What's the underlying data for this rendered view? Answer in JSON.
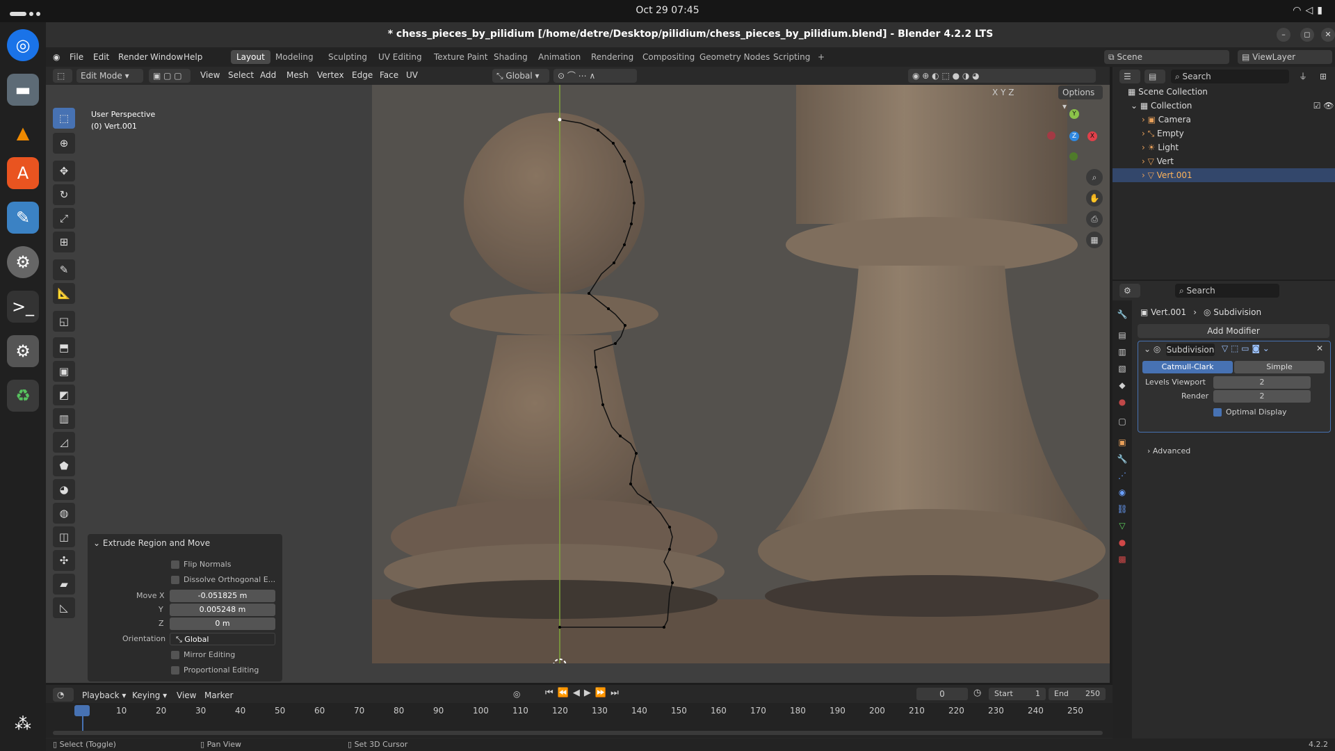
{
  "system": {
    "clock": "Oct 29  07:45"
  },
  "window": {
    "title": "* chess_pieces_by_pilidium [/home/detre/Desktop/pilidium/chess_pieces_by_pilidium.blend] - Blender 4.2.2 LTS"
  },
  "menu": [
    "File",
    "Edit",
    "Render",
    "Window",
    "Help"
  ],
  "workspaces": [
    "Layout",
    "Modeling",
    "Sculpting",
    "UV Editing",
    "Texture Paint",
    "Shading",
    "Animation",
    "Rendering",
    "Compositing",
    "Geometry Nodes",
    "Scripting"
  ],
  "scene": {
    "scene_label": "Scene",
    "viewlayer_label": "ViewLayer"
  },
  "viewport_header": {
    "mode": "Edit Mode",
    "menus": [
      "View",
      "Select",
      "Add",
      "Mesh",
      "Vertex",
      "Edge",
      "Face",
      "UV"
    ],
    "orientation": "Global",
    "options": "Options",
    "axes": [
      "X",
      "Y",
      "Z"
    ]
  },
  "viewport": {
    "perspective": "User Perspective",
    "object": "(0) Vert.001",
    "gizmo": {
      "x": "X",
      "y": "Y",
      "z": "Z"
    }
  },
  "operator_panel": {
    "title": "Extrude Region and Move",
    "flip_normals": "Flip Normals",
    "dissolve": "Dissolve Orthogonal E...",
    "move_x_label": "Move X",
    "move_x": "-0.051825 m",
    "y_label": "Y",
    "y": "0.005248 m",
    "z_label": "Z",
    "z": "0 m",
    "orientation_label": "Orientation",
    "orientation": "Global",
    "mirror": "Mirror Editing",
    "proportional": "Proportional Editing"
  },
  "outliner": {
    "search_placeholder": "Search",
    "scene_collection": "Scene Collection",
    "collection": "Collection",
    "items": [
      "Camera",
      "Empty",
      "Light",
      "Vert",
      "Vert.001"
    ]
  },
  "properties": {
    "search_placeholder": "Search",
    "object": "Vert.001",
    "modifier_breadcrumb": "Subdivision",
    "add_modifier": "Add Modifier",
    "modifier_name": "Subdivision",
    "catmull": "Catmull-Clark",
    "simple": "Simple",
    "levels_label": "Levels Viewport",
    "levels": "2",
    "render_label": "Render",
    "render": "2",
    "optimal": "Optimal Display",
    "advanced": "Advanced"
  },
  "timeline": {
    "menus": [
      "Playback",
      "Keying",
      "View",
      "Marker"
    ],
    "current_frame": "0",
    "start_label": "Start",
    "start": "1",
    "end_label": "End",
    "end": "250",
    "ticks": [
      "0",
      "10",
      "20",
      "30",
      "40",
      "50",
      "60",
      "70",
      "80",
      "90",
      "100",
      "110",
      "120",
      "130",
      "140",
      "150",
      "160",
      "170",
      "180",
      "190",
      "200",
      "210",
      "220",
      "230",
      "240",
      "250"
    ]
  },
  "statusbar": {
    "select": "Select (Toggle)",
    "pan": "Pan View",
    "cursor": "Set 3D Cursor",
    "version": "4.2.2"
  }
}
